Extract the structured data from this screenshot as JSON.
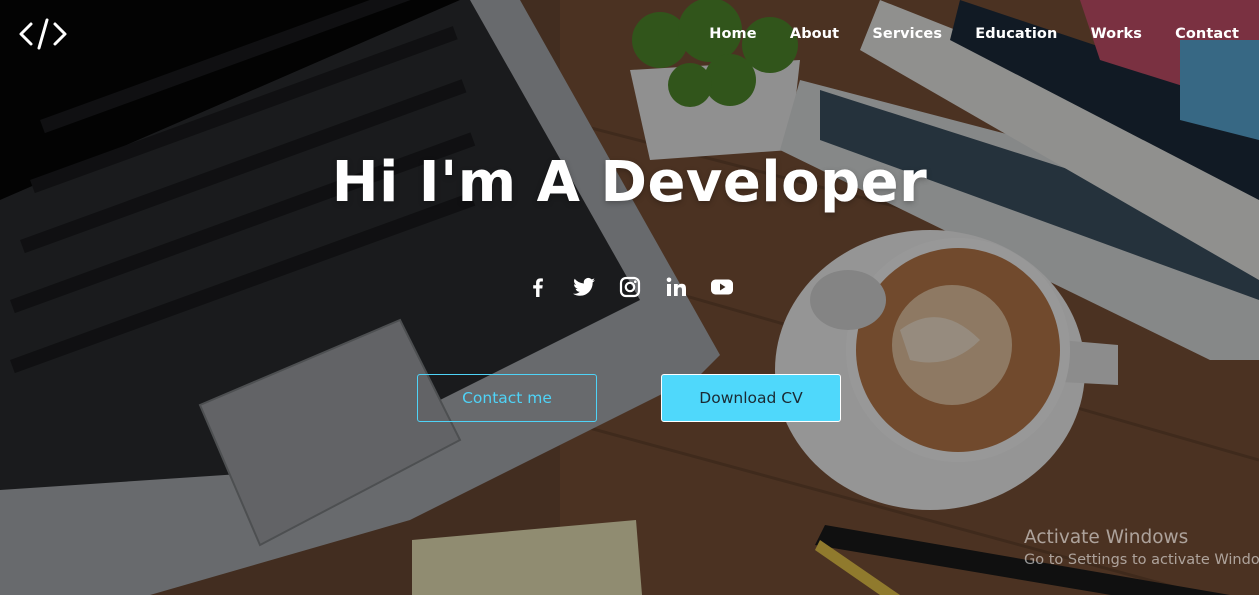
{
  "nav": {
    "items": [
      "Home",
      "About",
      "Services",
      "Education",
      "Works",
      "Contact"
    ]
  },
  "hero": {
    "title": "Hi I'm A Developer",
    "social": [
      "facebook-icon",
      "twitter-icon",
      "instagram-icon",
      "linkedin-icon",
      "youtube-icon"
    ],
    "contact_label": "Contact me",
    "download_label": "Download CV"
  },
  "watermark": {
    "line1": "Activate Windows",
    "line2": "Go to Settings to activate Windows."
  },
  "colors": {
    "accent": "#4fd8fb",
    "text": "#ffffff"
  }
}
